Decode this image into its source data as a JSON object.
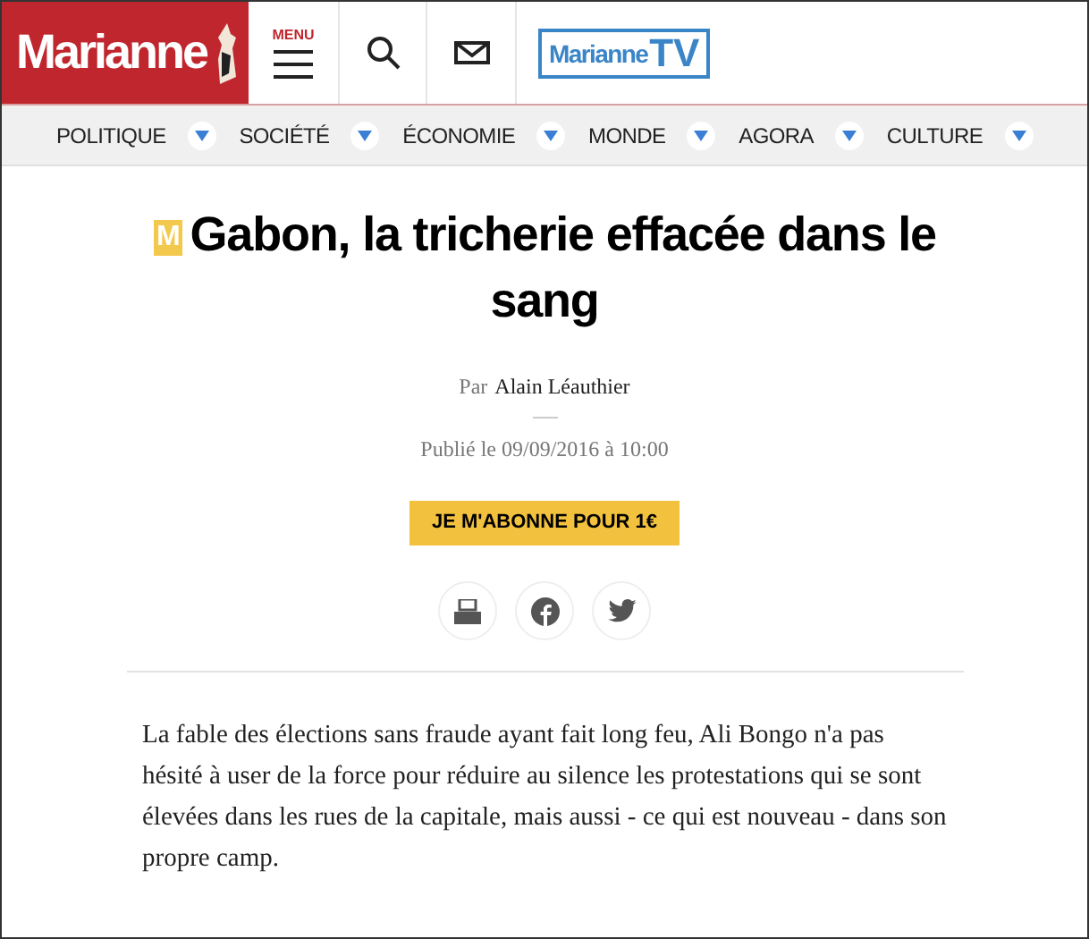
{
  "header": {
    "logo": "Marianne",
    "menu_label": "MENU",
    "tv_logo": {
      "name": "Marianne",
      "suffix": "TV"
    }
  },
  "nav": [
    {
      "label": "POLITIQUE"
    },
    {
      "label": "SOCIÉTÉ"
    },
    {
      "label": "ÉCONOMIE"
    },
    {
      "label": "MONDE"
    },
    {
      "label": "AGORA"
    },
    {
      "label": "CULTURE"
    }
  ],
  "article": {
    "badge": "M",
    "title": "Gabon, la tricherie effacée dans le sang",
    "byline_prefix": "Par",
    "author": "Alain Léauthier",
    "published": "Publié le 09/09/2016 à 10:00",
    "subscribe_button": "JE M'ABONNE POUR 1€",
    "share": [
      {
        "kind": "print"
      },
      {
        "kind": "facebook"
      },
      {
        "kind": "twitter"
      }
    ],
    "lead": "La fable des élections sans fraude ayant fait long feu, Ali Bongo n'a pas hésité à user de la force pour réduire au silence les protestations qui se sont élevées dans les rues de la capitale, mais aussi - ce qui est nouveau - dans son propre camp."
  }
}
